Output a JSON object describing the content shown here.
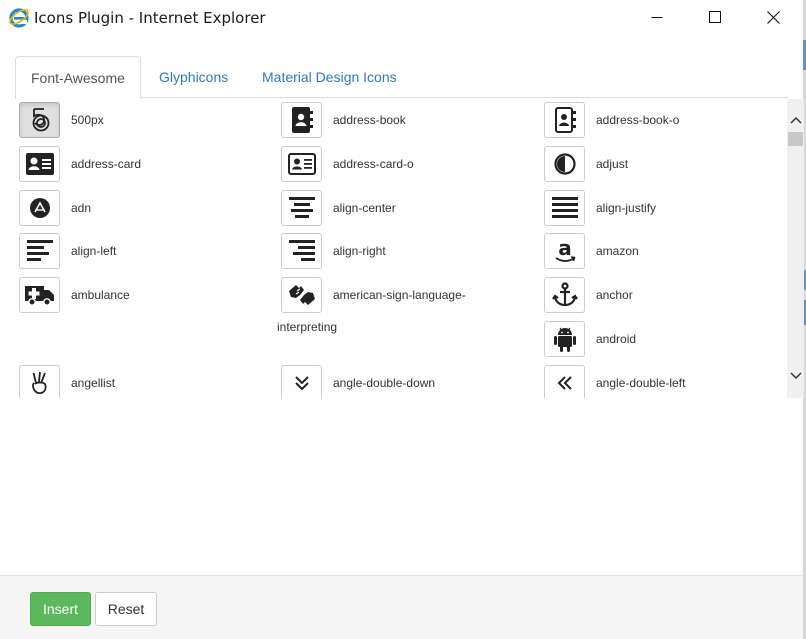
{
  "window": {
    "title": "Icons Plugin - Internet Explorer"
  },
  "tabs": [
    {
      "label": "Font-Awesome",
      "active": true
    },
    {
      "label": "Glyphicons",
      "active": false
    },
    {
      "label": "Material Design Icons",
      "active": false
    }
  ],
  "icons": {
    "col1": [
      {
        "name": "500px",
        "selected": true
      },
      {
        "name": "address-card"
      },
      {
        "name": "adn"
      },
      {
        "name": "align-left"
      },
      {
        "name": "ambulance"
      },
      {
        "name": "angellist"
      }
    ],
    "col2": [
      {
        "name": "address-book"
      },
      {
        "name": "address-card-o"
      },
      {
        "name": "align-center"
      },
      {
        "name": "align-right"
      },
      {
        "name": "american-sign-language-",
        "continuation": "interpreting"
      },
      {
        "name": "angle-double-down"
      }
    ],
    "col3": [
      {
        "name": "address-book-o"
      },
      {
        "name": "adjust"
      },
      {
        "name": "align-justify"
      },
      {
        "name": "amazon"
      },
      {
        "name": "anchor"
      },
      {
        "name": "android"
      },
      {
        "name": "angle-double-left"
      }
    ]
  },
  "footer": {
    "insert_label": "Insert",
    "reset_label": "Reset"
  },
  "colors": {
    "accent": "#5cb85c",
    "link": "#337ab7"
  }
}
